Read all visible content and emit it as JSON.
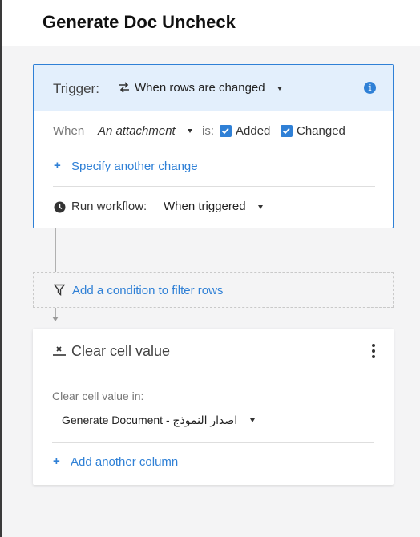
{
  "header": {
    "title": "Generate Doc Uncheck"
  },
  "trigger": {
    "label": "Trigger:",
    "event": "When rows are changed",
    "when_label": "When",
    "field": "An attachment",
    "is_label": "is:",
    "options": [
      {
        "label": "Added",
        "checked": true
      },
      {
        "label": "Changed",
        "checked": true
      }
    ],
    "specify_link": "Specify another change",
    "run_label": "Run workflow:",
    "run_value": "When triggered"
  },
  "condition": {
    "link": "Add a condition to filter rows"
  },
  "action": {
    "title": "Clear cell value",
    "in_label": "Clear cell value in:",
    "column": "Generate Document - اصدار النموذج",
    "add_link": "Add another column"
  },
  "colors": {
    "accent": "#2f80d6",
    "trigger_header_bg": "#e3effc",
    "panel_bg": "#f4f4f5"
  },
  "icons": {
    "trigger": "rows-changed-icon",
    "info": "info-icon",
    "run": "clock-icon",
    "condition": "filter-icon",
    "action": "clear-cell-icon",
    "menu": "kebab-menu-icon"
  }
}
